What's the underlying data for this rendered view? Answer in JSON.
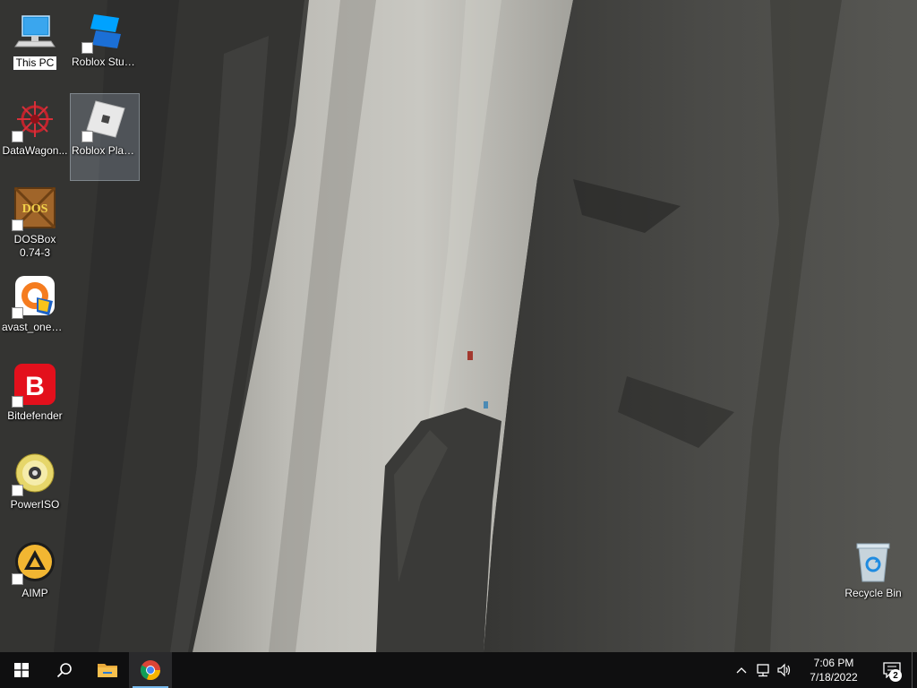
{
  "desktop": {
    "icons": [
      {
        "id": "this-pc",
        "label": "This PC"
      },
      {
        "id": "roblox-studio",
        "label": "Roblox Studio"
      },
      {
        "id": "datawagon",
        "label": "DataWagon..."
      },
      {
        "id": "roblox-player",
        "label": "Roblox Player"
      },
      {
        "id": "dosbox",
        "label": "DOSBox 0.74-3"
      },
      {
        "id": "avast",
        "label": "avast_one_e..."
      },
      {
        "id": "bitdefender",
        "label": "Bitdefender"
      },
      {
        "id": "poweriso",
        "label": "PowerISO"
      },
      {
        "id": "aimp",
        "label": "AIMP"
      },
      {
        "id": "recycle-bin",
        "label": "Recycle Bin"
      }
    ],
    "dosbox_logo_letters": "DOS"
  },
  "taskbar": {
    "start_icon": "windows-logo-icon",
    "search_icon": "search-icon",
    "pinned": [
      {
        "id": "file-explorer",
        "icon": "folder-icon"
      },
      {
        "id": "chrome",
        "icon": "chrome-icon"
      }
    ]
  },
  "tray": {
    "time": "7:06 PM",
    "date": "7/18/2022",
    "notification_count": "2"
  },
  "colors": {
    "taskbar_bg": "#0f0f10",
    "active_indicator": "#76b9ed",
    "bitdefender_red": "#e3101c",
    "aimp_yellow": "#f2b632"
  }
}
